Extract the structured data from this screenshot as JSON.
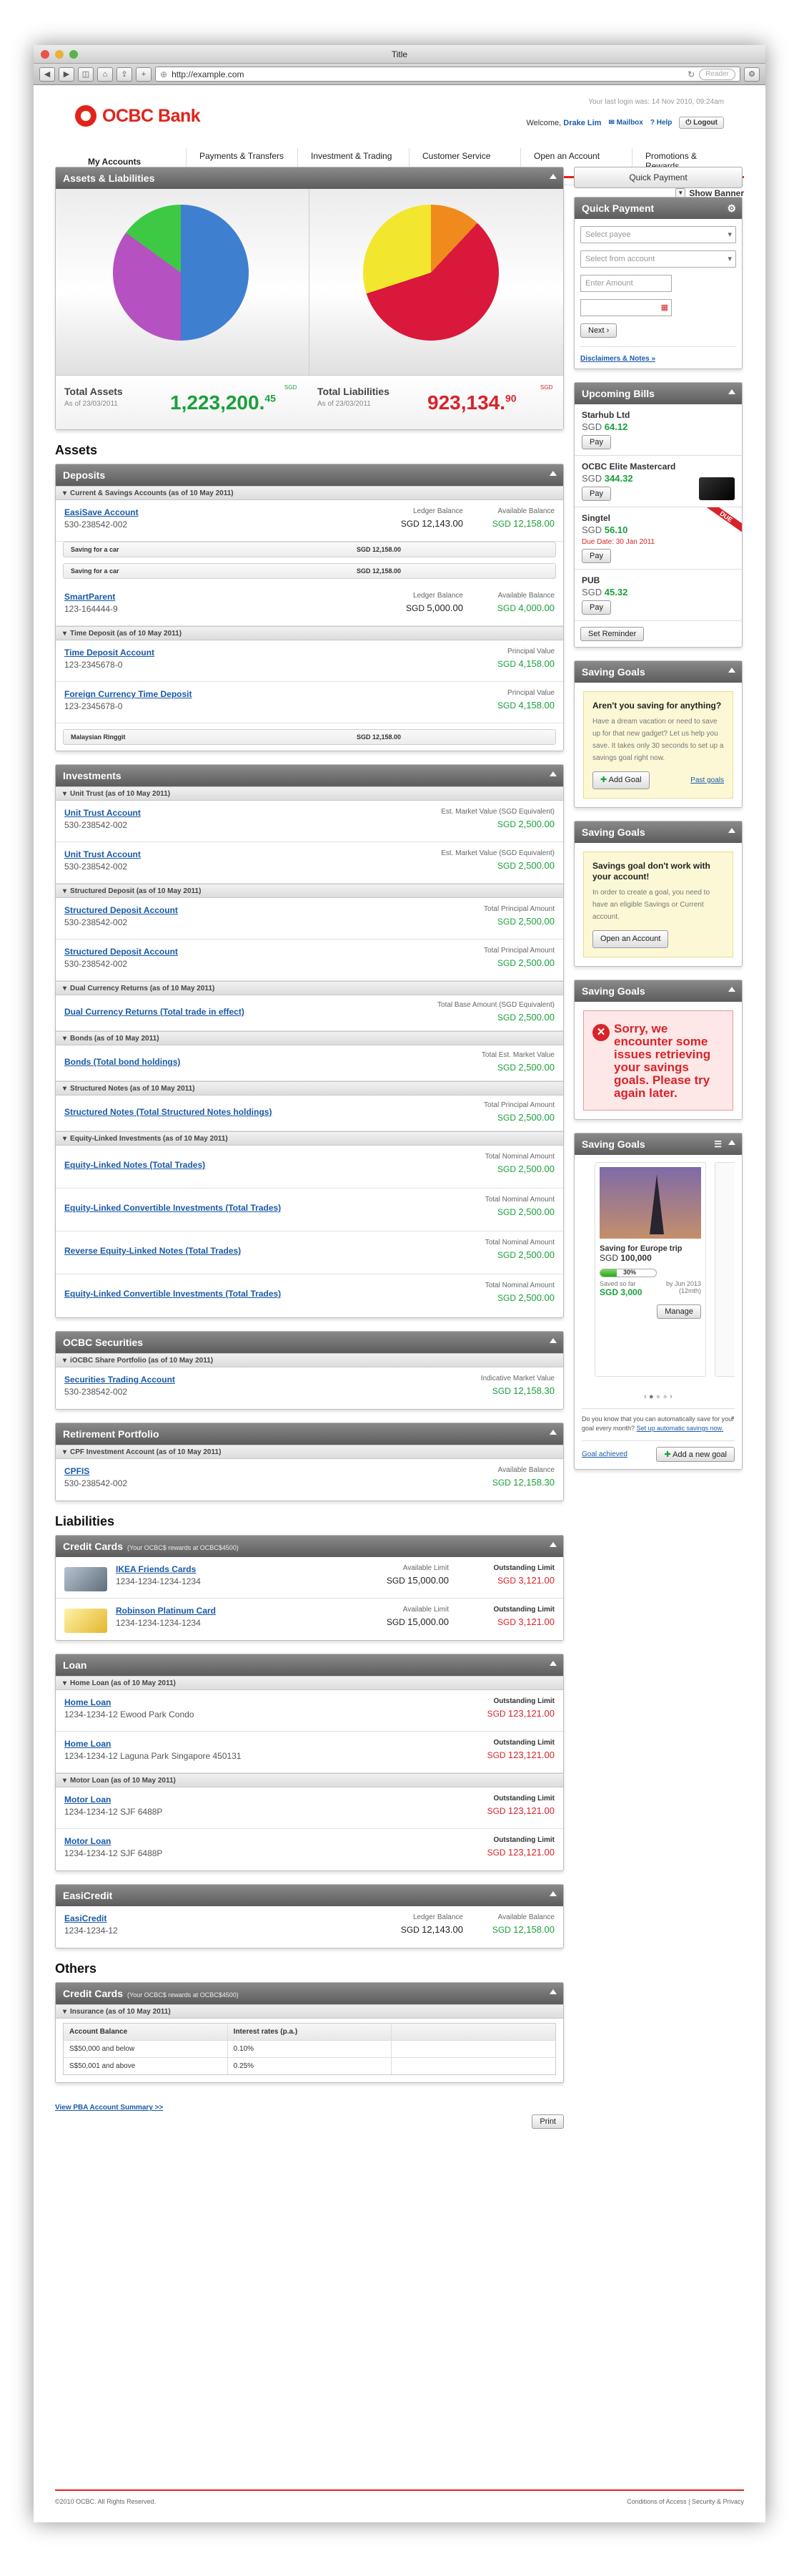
{
  "browser": {
    "title": "Title",
    "url": "http://example.com",
    "reader": "Reader"
  },
  "header": {
    "logo": "OCBC Bank",
    "last_login": "Your last login was: 14 Nov 2010, 09:24am",
    "welcome": "Welcome,",
    "user": "Drake Lim",
    "mailbox": "Mailbox",
    "help": "Help",
    "logout": "Logout"
  },
  "nav": [
    "My Accounts",
    "Payments & Transfers",
    "Investment & Trading",
    "Customer Service",
    "Open an Account",
    "Promotions & Rewards"
  ],
  "show_banner": "Show Banner",
  "summary": {
    "title": "Assets & Liabilities",
    "assets_label": "Total Assets",
    "assets_date": "As of 23/03/2011",
    "assets_value": "1,223,200.",
    "assets_cents": "45",
    "liab_label": "Total Liabilities",
    "liab_date": "As of 23/03/2011",
    "liab_value": "923,134.",
    "liab_cents": "90",
    "sgd": "SGD"
  },
  "assets_heading": "Assets",
  "deposits": {
    "title": "Deposits",
    "casa_sub": "Current & Savings Accounts (as of 10 May 2011)",
    "td_sub": "Time Deposit (as of 10 May 2011)",
    "easi": {
      "name": "EasiSave Account",
      "no": "530-238542-002",
      "ledger_lbl": "Ledger Balance",
      "ledger": "12,143.00",
      "avail_lbl": "Available Balance",
      "avail": "12,158.00"
    },
    "save1": {
      "label": "Saving for a car",
      "amt": "SGD 12,158.00"
    },
    "save2": {
      "label": "Saving for a car",
      "amt": "SGD 12,158.00"
    },
    "smart": {
      "name": "SmartParent",
      "no": "123-164444-9",
      "ledger_lbl": "Ledger Balance",
      "ledger": "5,000.00",
      "avail_lbl": "Available Balance",
      "avail": "4,000.00"
    },
    "td": {
      "name": "Time Deposit Account",
      "no": "123-2345678-0",
      "lbl": "Principal Value",
      "val": "4,158.00"
    },
    "fctd": {
      "name": "Foreign Currency Time Deposit",
      "no": "123-2345678-0",
      "lbl": "Principal Value",
      "val": "4,158.00"
    },
    "myr": {
      "label": "Malaysian Ringgit",
      "amt": "SGD 12,158.00"
    }
  },
  "investments": {
    "title": "Investments",
    "ut_sub": "Unit Trust (as of 10 May 2011)",
    "sd_sub": "Structured Deposit (as of 10 May 2011)",
    "dcr_sub": "Dual Currency Returns (as of 10 May 2011)",
    "bonds_sub": "Bonds (as of 10 May 2011)",
    "sn_sub": "Structured Notes (as of 10 May 2011)",
    "eli_sub": "Equity-Linked Investments (as of 10 May 2011)",
    "ut1": {
      "name": "Unit Trust Account",
      "no": "530-238542-002",
      "lbl": "Est. Market Value (SGD Equivalent)",
      "val": "2,500.00"
    },
    "ut2": {
      "name": "Unit Trust Account",
      "no": "530-238542-002",
      "lbl": "Est. Market Value (SGD Equivalent)",
      "val": "2,500.00"
    },
    "sd1": {
      "name": "Structured Deposit Account",
      "no": "530-238542-002",
      "lbl": "Total Principal Amount",
      "val": "2,500.00"
    },
    "sd2": {
      "name": "Structured Deposit Account",
      "no": "530-238542-002",
      "lbl": "Total Principal Amount",
      "val": "2,500.00"
    },
    "dcr": {
      "name": "Dual Currency Returns (Total trade in effect)",
      "lbl": "Total Base Amount (SGD Equivalent)",
      "val": "2,500.00"
    },
    "bonds": {
      "name": "Bonds (Total bond holdings)",
      "lbl": "Total Est. Market Value",
      "val": "2,500.00"
    },
    "sn": {
      "name": "Structured Notes (Total Structured Notes holdings)",
      "lbl": "Total Principal Amount",
      "val": "2,500.00"
    },
    "eli1": {
      "name": "Equity-Linked Notes (Total Trades)",
      "lbl": "Total Nominal Amount",
      "val": "2,500.00"
    },
    "eli2": {
      "name": "Equity-Linked Convertible Investments (Total Trades)",
      "lbl": "Total Nominal Amount",
      "val": "2,500.00"
    },
    "eli3": {
      "name": "Reverse Equity-Linked Notes (Total Trades)",
      "lbl": "Total Nominal Amount",
      "val": "2,500.00"
    },
    "eli4": {
      "name": "Equity-Linked Convertible Investments (Total Trades)",
      "lbl": "Total Nominal Amount",
      "val": "2,500.00"
    }
  },
  "securities": {
    "title": "OCBC Securities",
    "sub": "iOCBC Share Portfolio (as of 10 May 2011)",
    "name": "Securities Trading Account",
    "no": "530-238542-002",
    "lbl": "Indicative Market Value",
    "val": "12,158.30"
  },
  "retirement": {
    "title": "Retirement Portfolio",
    "sub": "CPF Investment Account (as of 10 May 2011)",
    "name": "CPFIS",
    "no": "530-238542-002",
    "lbl": "Available Balance",
    "val": "12,158.30"
  },
  "liab_heading": "Liabilities",
  "cards": {
    "title": "Credit Cards",
    "note": "(Your OCBC$ rewards at OCBC$4500)",
    "c1": {
      "name": "IKEA Friends Cards",
      "no": "1234-1234-1234-1234",
      "al": "Available Limit",
      "av": "15,000.00",
      "ol": "Outstanding Limit",
      "ov": "3,121.00"
    },
    "c2": {
      "name": "Robinson Platinum Card",
      "no": "1234-1234-1234-1234",
      "al": "Available Limit",
      "av": "15,000.00",
      "ol": "Outstanding Limit",
      "ov": "3,121.00"
    }
  },
  "loan": {
    "title": "Loan",
    "home_sub": "Home Loan (as of 10 May 2011)",
    "motor_sub": "Motor Loan (as of 10 May 2011)",
    "h1": {
      "name": "Home Loan",
      "no": "1234-1234-12 Ewood Park Condo",
      "lbl": "Outstanding Limit",
      "val": "123,121.00"
    },
    "h2": {
      "name": "Home Loan",
      "no": "1234-1234-12 Laguna Park Singapore 450131",
      "lbl": "Outstanding Limit",
      "val": "123,121.00"
    },
    "m1": {
      "name": "Motor Loan",
      "no": "1234-1234-12 SJF 6488P",
      "lbl": "Outstanding Limit",
      "val": "123,121.00"
    },
    "m2": {
      "name": "Motor Loan",
      "no": "1234-1234-12 SJF 6488P",
      "lbl": "Outstanding Limit",
      "val": "123,121.00"
    }
  },
  "easicredit": {
    "title": "EasiCredit",
    "name": "EasiCredit",
    "no": "1234-1234-12",
    "ledger_lbl": "Ledger Balance",
    "ledger": "12,143.00",
    "avail_lbl": "Available Balance",
    "avail": "12,158.00"
  },
  "others_heading": "Others",
  "others": {
    "title": "Credit Cards",
    "note": "(Your OCBC$ rewards at OCBC$4500)",
    "sub": "Insurance (as of 10 May 2011)",
    "h1": "Account Balance",
    "h2": "Interest rates (p.a.)",
    "r1a": "S$50,000 and below",
    "r1b": "0.10%",
    "r2a": "S$50,001 and above",
    "r2b": "0.25%"
  },
  "pba_link": "View PBA Account Summary >>",
  "print": "Print",
  "footer": {
    "copy": "©2010 OCBC. All Rights Reserved.",
    "links": "Conditions of Access | Security & Privacy"
  },
  "side": {
    "quick_btn": "Quick Payment",
    "qp_title": "Quick Payment",
    "payee": "Select payee",
    "from": "Select from account",
    "amount": "Enter Amount",
    "next": "Next",
    "disclaim": "Disclaimers & Notes »",
    "bills_title": "Upcoming Bills",
    "pay": "Pay",
    "reminder": "Set Reminder",
    "b1": {
      "name": "Starhub Ltd",
      "cur": "SGD",
      "amt": "64.12"
    },
    "b2": {
      "name": "OCBC Elite Mastercard",
      "cur": "SGD",
      "amt": "344.32"
    },
    "b3": {
      "name": "Singtel",
      "cur": "SGD",
      "amt": "56.10",
      "due": "Due Date: 30 Jan 2011",
      "flag": "DUE"
    },
    "b4": {
      "name": "PUB",
      "cur": "SGD",
      "amt": "45.32"
    },
    "g1_title": "Saving Goals",
    "g1_head": "Aren't you saving for anything?",
    "g1_text": "Have a dream vacation or need to save up for that new gadget? Let us help you save. It takes only 30 seconds to set up a savings goal right now.",
    "g1_add": "Add Goal",
    "g1_past": "Past goals",
    "g2_title": "Saving Goals",
    "g2_head": "Savings goal don't work with your account!",
    "g2_text": "In order to create a goal, you need to have an eligible Savings or Current account.",
    "g2_btn": "Open an Account",
    "g3_title": "Saving Goals",
    "g3_err": "Sorry, we encounter some issues retrieving your savings goals. Please try again later.",
    "g4_title": "Saving Goals",
    "goal_name": "Saving for Europe trip",
    "goal_cur": "SGD",
    "goal_target": "100,000",
    "goal_pct": "30%",
    "goal_saved_lbl": "Saved so far",
    "goal_saved": "3,000",
    "goal_by": "by Jun 2013",
    "goal_months": "(12mth)",
    "goal_manage": "Manage",
    "goal_progress": 0.3,
    "tip_text": "Do you know that you can automatically save for your goal every month?",
    "tip_link": "Set up automatic savings now.",
    "achieved": "Goal achieved",
    "add_new": "Add a new goal"
  }
}
